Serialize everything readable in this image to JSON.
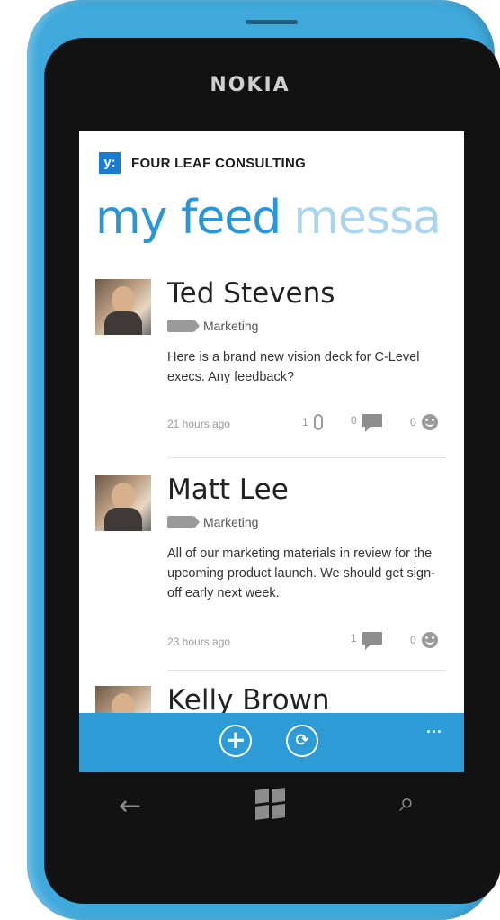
{
  "device": {
    "brand": "NOKIA"
  },
  "header": {
    "logo_text": "y:",
    "company": "FOUR LEAF CONSULTING"
  },
  "pivot": {
    "active_tab": "my feed",
    "next_tab": "messa"
  },
  "posts": [
    {
      "author": "Ted Stevens",
      "group": "Marketing",
      "body": "Here is a brand new vision deck for C-Level execs. Any feedback?",
      "time": "21 hours ago",
      "attachments": "1",
      "replies": "0",
      "likes": "0"
    },
    {
      "author": "Matt Lee",
      "group": "Marketing",
      "body": "All of our marketing materials in review for the upcoming product launch. We should get sign-off early next week.",
      "time": "23 hours ago",
      "replies": "1",
      "likes": "0"
    },
    {
      "author": "Kelly Brown"
    }
  ],
  "appbar": {
    "add_icon": "+",
    "sync_icon": "⟳",
    "more": "..."
  },
  "hardware": {
    "back_icon": "←",
    "search_icon": "⌕"
  },
  "colors": {
    "phone": "#3fa9dc",
    "accent": "#2896d8",
    "appbar": "#2d9bd6"
  }
}
